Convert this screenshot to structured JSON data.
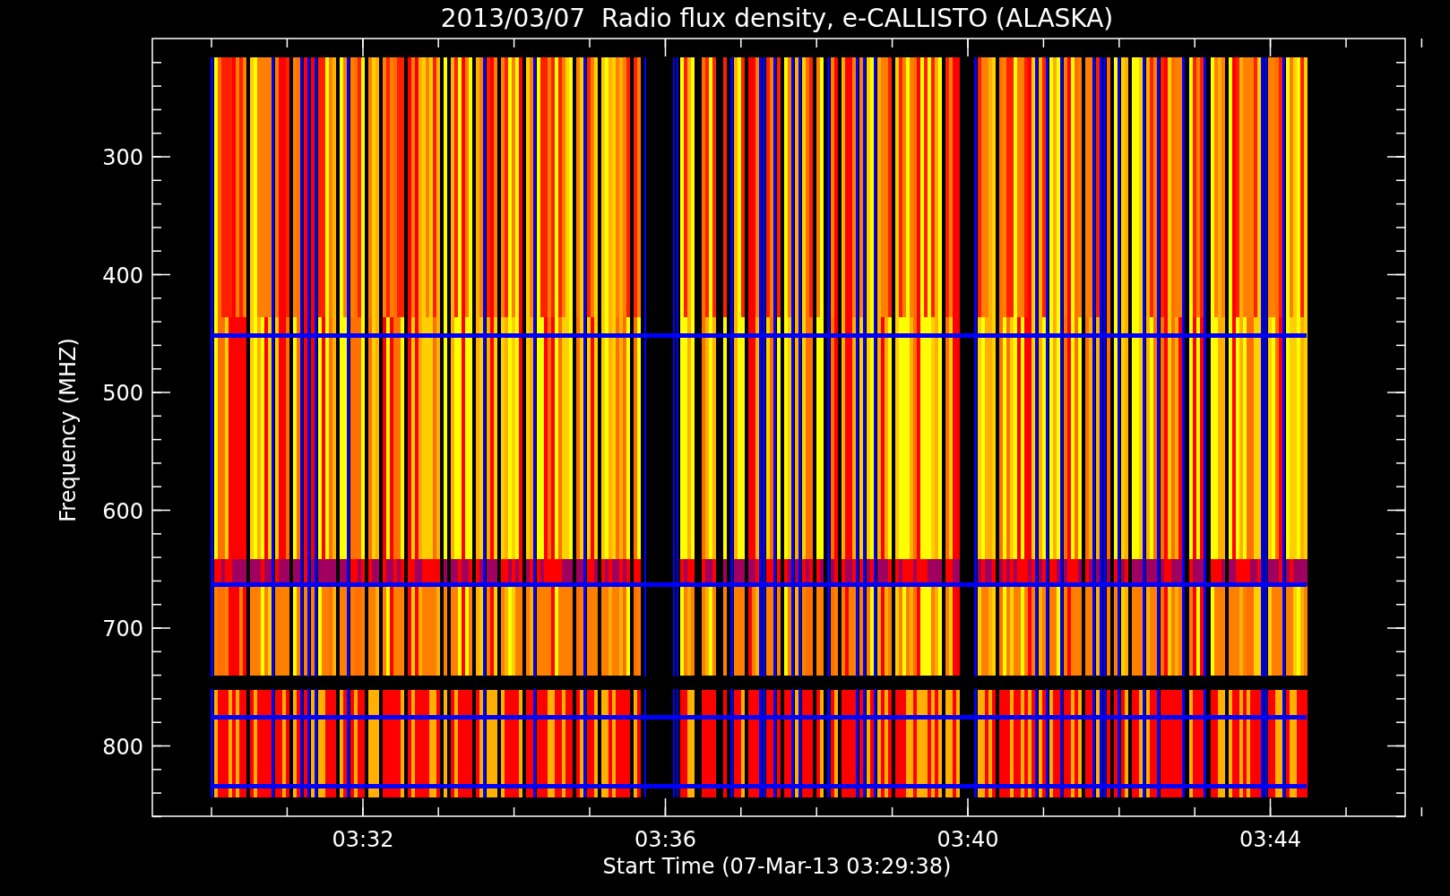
{
  "title": "2013/03/07  Radio flux density, e-CALLISTO (ALASKA)",
  "y_axis": {
    "label": "Frequency (MHZ)",
    "ticks": [
      "300",
      "400",
      "500",
      "600",
      "700",
      "800"
    ]
  },
  "x_axis": {
    "label": "Start Time (07-Mar-13 03:29:38)",
    "ticks": [
      "03:32",
      "03:36",
      "03:40",
      "03:44"
    ]
  }
}
